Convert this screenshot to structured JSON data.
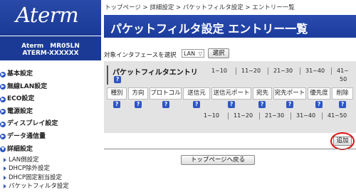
{
  "sidebar": {
    "logo": "Aterm",
    "model_line1": "Aterm　MR05LN",
    "model_line2": "ATERM-XXXXXX",
    "items": [
      {
        "label": "基本設定"
      },
      {
        "label": "無線LAN設定"
      },
      {
        "label": "ECO設定"
      },
      {
        "label": "電源設定"
      },
      {
        "label": "ディスプレイ設定"
      },
      {
        "label": "データ通信量"
      },
      {
        "label": "詳細設定"
      }
    ],
    "sub_items": [
      {
        "label": "LAN側設定"
      },
      {
        "label": "DHCP除外設定"
      },
      {
        "label": "DHCP固定割当設定"
      },
      {
        "label": "パケットフィルタ設定"
      }
    ]
  },
  "breadcrumb": "トップページ > 詳細設定 > パケットフィルタ設定 > エントリー一覧",
  "title": "パケットフィルタ設定 エントリー一覧",
  "interface": {
    "label": "対象インタフェースを選択",
    "selected": "LAN",
    "button": "選択"
  },
  "panel": {
    "title": "パケットフィルタエントリ",
    "help": "?",
    "ranges_top": [
      "1~10",
      "11~20",
      "21~30",
      "31~40",
      "41~"
    ],
    "range_top_tail": "50",
    "ranges_bottom": [
      "1~10",
      "11~20",
      "21~30",
      "31~40",
      "41~50"
    ],
    "columns": [
      "種別",
      "方向",
      "プロトコル",
      "送信元",
      "送信元ポート",
      "宛先",
      "宛先ポート",
      "優先度",
      "削除"
    ]
  },
  "add_button": "追加",
  "top_button": "トップページへ戻る",
  "colors": {
    "brand_blue": "#1b3c9c",
    "highlight_red": "#e01010"
  }
}
